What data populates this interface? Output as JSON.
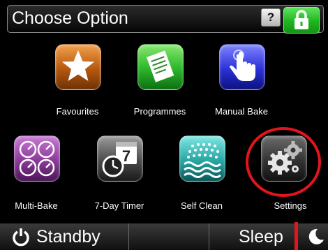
{
  "header": {
    "title": "Choose Option",
    "help_label": "?",
    "lock_icon": "padlock-icon"
  },
  "options": [
    {
      "label": "Favourites",
      "icon": "star-icon",
      "color": "#d7721e"
    },
    {
      "label": "Programmes",
      "icon": "document-icon",
      "color": "#2ab52a"
    },
    {
      "label": "Manual Bake",
      "icon": "hand-pointer-icon",
      "color": "#2b31d6"
    },
    {
      "label": "Multi-Bake",
      "icon": "four-dials-icon",
      "color": "#8c3a99"
    },
    {
      "label": "7-Day Timer",
      "icon": "clock-calendar-icon",
      "calendar_digit": "7",
      "color": "#4a4a4a"
    },
    {
      "label": "Self Clean",
      "icon": "steam-water-icon",
      "color": "#26a6a3"
    },
    {
      "label": "Settings",
      "icon": "gears-icon",
      "color": "#333333"
    }
  ],
  "footer": {
    "standby_label": "Standby",
    "standby_icon": "power-icon",
    "sleep_label": "Sleep",
    "sleep_icon": "moon-icon"
  },
  "annotation": {
    "highlight_color": "#e2141c",
    "highlighted_option": "Settings"
  }
}
